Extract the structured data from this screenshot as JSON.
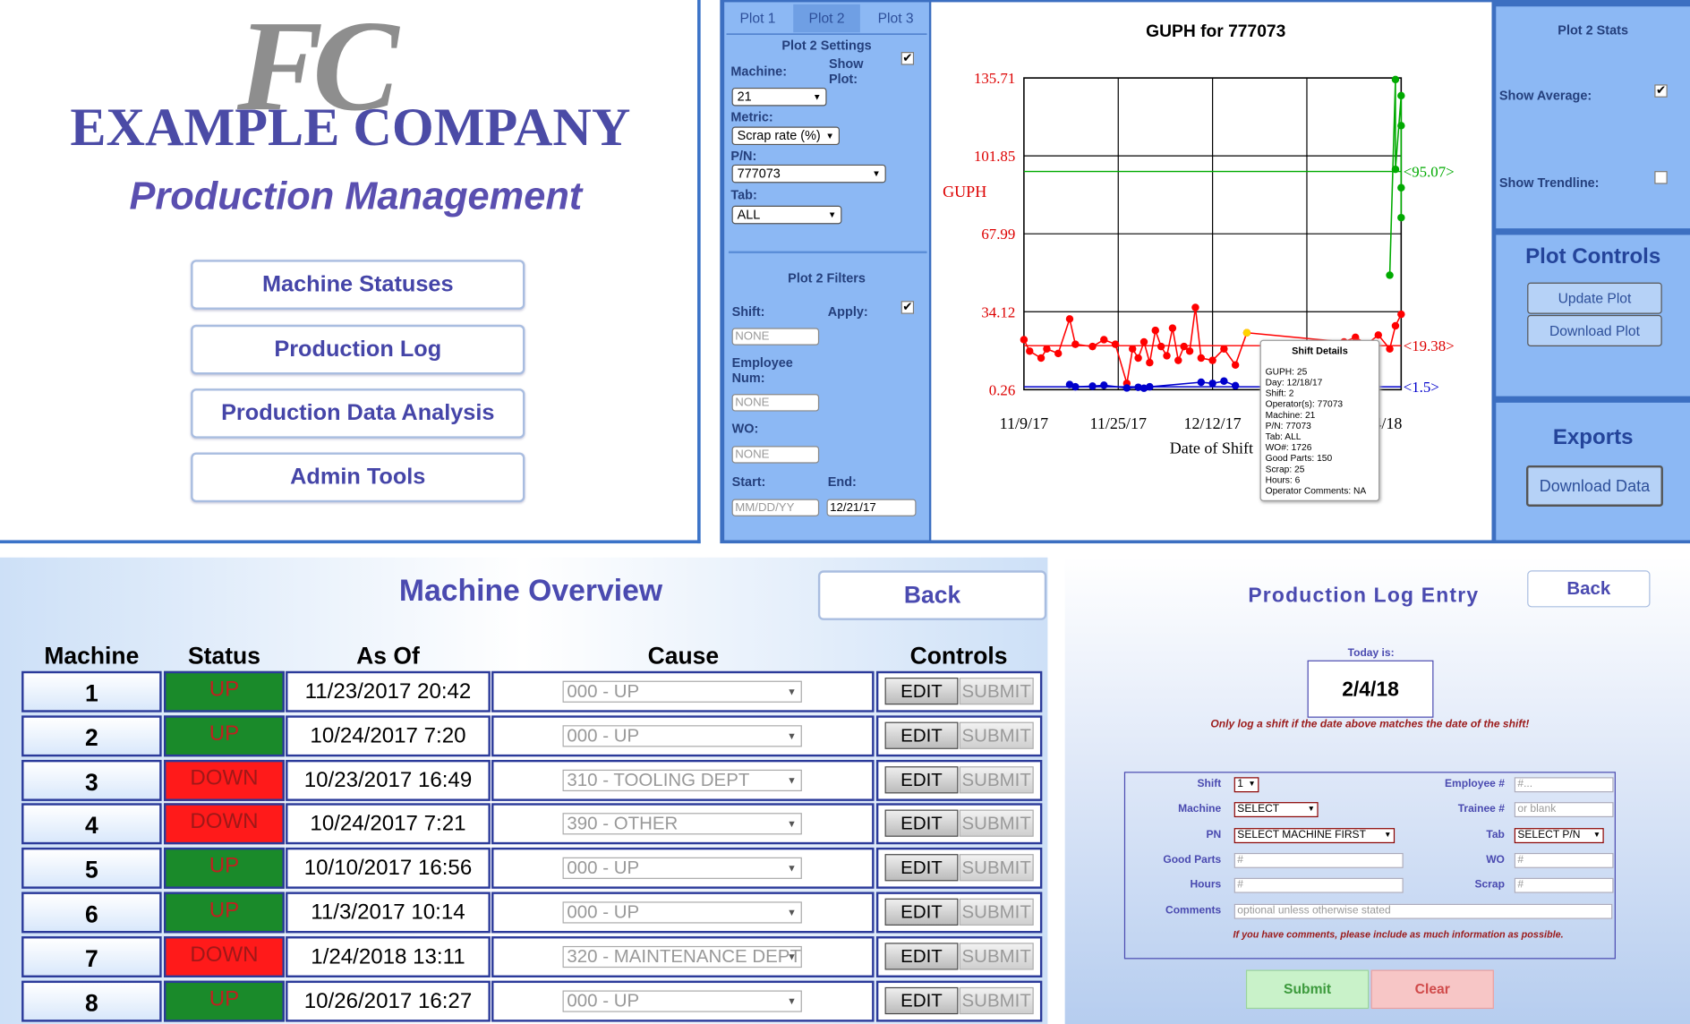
{
  "home": {
    "logo_text": "FC",
    "company": "EXAMPLE COMPANY",
    "subtitle": "Production Management",
    "nav": [
      "Machine Statuses",
      "Production Log",
      "Production Data Analysis",
      "Admin Tools"
    ]
  },
  "plot_page": {
    "tabs": [
      "Plot 1",
      "Plot 2",
      "Plot 3"
    ],
    "active_tab": "Plot 2",
    "settings": {
      "title": "Plot 2 Settings",
      "machine_label": "Machine:",
      "show_plot_label": "Show\nPlot:",
      "machine_value": "21",
      "metric_label": "Metric:",
      "metric_value": "Scrap rate (%)",
      "pn_label": "P/N:",
      "pn_value": "777073",
      "tab_label": "Tab:",
      "tab_value": "ALL"
    },
    "filters": {
      "title": "Plot 2 Filters",
      "shift_label": "Shift:",
      "apply_label": "Apply:",
      "shift_value": "NONE",
      "employee_label": "Employee\nNum:",
      "employee_value": "NONE",
      "wo_label": "WO:",
      "wo_value": "NONE",
      "start_label": "Start:",
      "end_label": "End:",
      "start_placeholder": "MM/DD/YY",
      "end_value": "12/21/17"
    },
    "stats": {
      "title": "Plot 2 Stats",
      "show_average": "Show Average:",
      "show_trendline": "Show Trendline:"
    },
    "controls": {
      "title": "Plot Controls",
      "update": "Update Plot",
      "download": "Download Plot"
    },
    "exports": {
      "title": "Exports",
      "download": "Download Data"
    },
    "tooltip": {
      "title": "Shift Details",
      "lines": [
        "GUPH: 25",
        "Day: 12/18/17",
        "Shift: 2",
        "Operator(s): 77073",
        "Machine: 21",
        "P/N: 77073",
        "Tab: ALL",
        "WO#: 1726",
        "Good Parts: 150",
        "Scrap: 25",
        "Hours: 6",
        "Operator Comments: NA"
      ]
    }
  },
  "chart_data": {
    "type": "line",
    "title": "GUPH for 777073",
    "ylabel": "GUPH",
    "xlabel": "Date of Shift",
    "y_ticks": [
      "135.71",
      "101.85",
      "67.99",
      "34.12",
      "0.26"
    ],
    "y_tick_values": [
      135.71,
      101.85,
      67.99,
      34.12,
      0.26
    ],
    "x_ticks": [
      "11/9/17",
      "11/25/17",
      "12/12/17",
      "",
      "1/14/18"
    ],
    "x_range": [
      "2017-11-09",
      "2018-01-14"
    ],
    "ylim": [
      0.26,
      135.71
    ],
    "grid": true,
    "annotations": [
      "<95.07>",
      "<19.38>",
      "<1.5>"
    ],
    "series": [
      {
        "color": "#ff0000",
        "average": 19.38,
        "values": [
          {
            "x": "2017-11-09",
            "y": 22
          },
          {
            "x": "2017-11-10",
            "y": 17
          },
          {
            "x": "2017-11-12",
            "y": 14
          },
          {
            "x": "2017-11-13",
            "y": 18
          },
          {
            "x": "2017-11-15",
            "y": 16
          },
          {
            "x": "2017-11-17",
            "y": 31
          },
          {
            "x": "2017-11-18",
            "y": 20
          },
          {
            "x": "2017-11-21",
            "y": 19
          },
          {
            "x": "2017-11-23",
            "y": 22
          },
          {
            "x": "2017-11-25",
            "y": 20
          },
          {
            "x": "2017-11-27",
            "y": 3
          },
          {
            "x": "2017-11-28",
            "y": 18
          },
          {
            "x": "2017-11-29",
            "y": 14
          },
          {
            "x": "2017-11-30",
            "y": 21
          },
          {
            "x": "2017-12-01",
            "y": 12
          },
          {
            "x": "2017-12-02",
            "y": 26
          },
          {
            "x": "2017-12-03",
            "y": 19
          },
          {
            "x": "2017-12-04",
            "y": 15
          },
          {
            "x": "2017-12-05",
            "y": 27
          },
          {
            "x": "2017-12-06",
            "y": 13
          },
          {
            "x": "2017-12-07",
            "y": 19
          },
          {
            "x": "2017-12-08",
            "y": 17
          },
          {
            "x": "2017-12-09",
            "y": 36
          },
          {
            "x": "2017-12-10",
            "y": 14
          },
          {
            "x": "2017-12-12",
            "y": 13
          },
          {
            "x": "2017-12-14",
            "y": 18
          },
          {
            "x": "2017-12-16",
            "y": 11
          },
          {
            "x": "2017-12-18",
            "y": 25
          },
          {
            "x": "2018-01-04",
            "y": 21
          },
          {
            "x": "2018-01-06",
            "y": 23
          },
          {
            "x": "2018-01-08",
            "y": 20
          },
          {
            "x": "2018-01-10",
            "y": 24
          },
          {
            "x": "2018-01-12",
            "y": 18
          },
          {
            "x": "2018-01-13",
            "y": 28
          },
          {
            "x": "2018-01-14",
            "y": 33
          }
        ]
      },
      {
        "color": "#0000cc",
        "average": 1.5,
        "values": [
          {
            "x": "2017-11-17",
            "y": 2.5
          },
          {
            "x": "2017-11-18",
            "y": 1.5
          },
          {
            "x": "2017-11-21",
            "y": 1.8
          },
          {
            "x": "2017-11-23",
            "y": 2.2
          },
          {
            "x": "2017-11-27",
            "y": 1.0
          },
          {
            "x": "2017-11-29",
            "y": 1.3
          },
          {
            "x": "2017-11-30",
            "y": 0.9
          },
          {
            "x": "2017-12-01",
            "y": 1.5
          },
          {
            "x": "2017-12-10",
            "y": 3.5
          },
          {
            "x": "2017-12-12",
            "y": 3.0
          },
          {
            "x": "2017-12-14",
            "y": 4.0
          },
          {
            "x": "2017-12-16",
            "y": 2.0
          }
        ]
      },
      {
        "color": "#00aa00",
        "average": 95.07,
        "values": [
          {
            "x": "2018-01-12",
            "y": 50
          },
          {
            "x": "2018-01-13",
            "y": 135
          },
          {
            "x": "2018-01-13",
            "y": 96
          },
          {
            "x": "2018-01-14",
            "y": 128
          },
          {
            "x": "2018-01-14",
            "y": 88
          },
          {
            "x": "2018-01-14",
            "y": 115
          },
          {
            "x": "2018-01-14",
            "y": 75
          }
        ]
      }
    ]
  },
  "overview": {
    "title": "Machine Overview",
    "back": "Back",
    "headers": [
      "Machine",
      "Status",
      "As Of",
      "Cause",
      "Controls"
    ],
    "edit": "EDIT",
    "submit": "SUBMIT",
    "rows": [
      {
        "machine": "1",
        "status": "UP",
        "as_of": "11/23/2017 20:42",
        "cause": "000 - UP"
      },
      {
        "machine": "2",
        "status": "UP",
        "as_of": "10/24/2017 7:20",
        "cause": "000 - UP"
      },
      {
        "machine": "3",
        "status": "DOWN",
        "as_of": "10/23/2017 16:49",
        "cause": "310 - TOOLING DEPT"
      },
      {
        "machine": "4",
        "status": "DOWN",
        "as_of": "10/24/2017 7:21",
        "cause": "390 - OTHER"
      },
      {
        "machine": "5",
        "status": "UP",
        "as_of": "10/10/2017 16:56",
        "cause": "000 - UP"
      },
      {
        "machine": "6",
        "status": "UP",
        "as_of": "11/3/2017 10:14",
        "cause": "000 - UP"
      },
      {
        "machine": "7",
        "status": "DOWN",
        "as_of": "1/24/2018 13:11",
        "cause": "320 - MAINTENANCE DEPT"
      },
      {
        "machine": "8",
        "status": "UP",
        "as_of": "10/26/2017 16:27",
        "cause": "000 - UP"
      }
    ],
    "colors": {
      "up": "#1a8a2a",
      "down": "#ff1a1a"
    }
  },
  "log_entry": {
    "title": "Production Log Entry",
    "back": "Back",
    "today_label": "Today is:",
    "today": "2/4/18",
    "warning": "Only log a shift if the date above matches the date of the shift!",
    "shift_label": "Shift",
    "shift_value": "1",
    "employee_label": "Employee #",
    "employee_placeholder": "#...",
    "machine_label": "Machine",
    "machine_value": "SELECT",
    "trainee_label": "Trainee #",
    "trainee_placeholder": "or blank",
    "pn_label": "PN",
    "pn_value": "SELECT MACHINE FIRST",
    "tab_label": "Tab",
    "tab_value": "SELECT P/N",
    "good_parts_label": "Good Parts",
    "good_parts_placeholder": "#",
    "wo_label": "WO",
    "wo_placeholder": "#",
    "hours_label": "Hours",
    "hours_placeholder": "#",
    "scrap_label": "Scrap",
    "scrap_placeholder": "#",
    "comments_label": "Comments",
    "comments_placeholder": "optional unless otherwise stated",
    "note": "If you have comments, please include as much information as possible.",
    "submit": "Submit",
    "clear": "Clear"
  }
}
